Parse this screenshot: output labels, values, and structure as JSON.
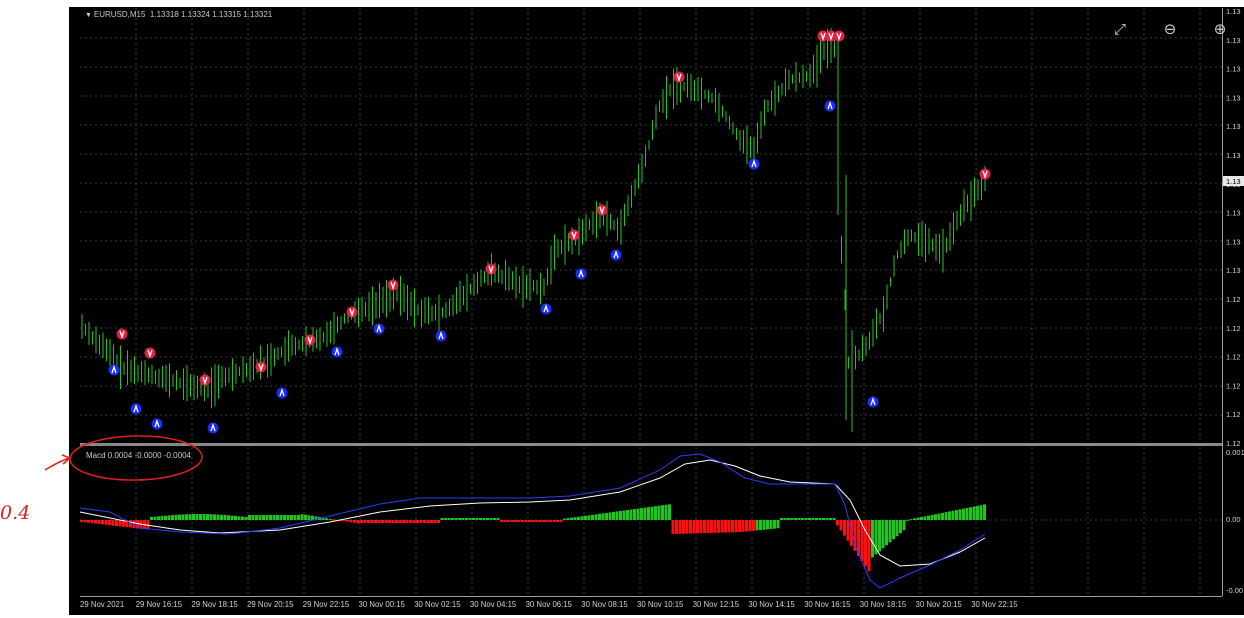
{
  "window": {
    "title": "EURUSD,M15",
    "ohlc": "1.13318 1.13324 1.13315 1.13321"
  },
  "zoom_controls": {
    "fit_icon": "fullscreen-icon",
    "zoom_out_icon": "zoom-out-icon",
    "zoom_in_icon": "zoom-in-icon"
  },
  "price_axis": {
    "labels": [
      "1.13",
      "1.13",
      "1.13",
      "1.13",
      "1.13",
      "1.13",
      "1.13",
      "1.13",
      "1.13",
      "1.13",
      "1.12",
      "1.12",
      "1.12",
      "1.12",
      "1.12",
      "1.12"
    ],
    "current_price": "1.13"
  },
  "time_axis": {
    "labels": [
      "29 Nov 2021",
      "29 Nov 16:15",
      "29 Nov 18:15",
      "29 Nov 20:15",
      "29 Nov 22:15",
      "30 Nov 00:15",
      "30 Nov 02:15",
      "30 Nov 04:15",
      "30 Nov 06:15",
      "30 Nov 08:15",
      "30 Nov 10:15",
      "30 Nov 12:15",
      "30 Nov 14:15",
      "30 Nov 16:15",
      "30 Nov 18:15",
      "30 Nov 20:15",
      "30 Nov 22:15"
    ]
  },
  "macd": {
    "label": "Macd 0.0004 -0.0000 -0.0004",
    "axis_labels": [
      "0.001",
      "0.00",
      "-0.00"
    ]
  },
  "annotation": {
    "text": "0.4",
    "color": "#e02020"
  },
  "colors": {
    "background": "#000000",
    "bars": "#22c422",
    "grid": "#3a3a3a",
    "hist_up": "#22c422",
    "hist_down": "#ff1010",
    "macd_line": "#2b3cff",
    "signal_line": "#ffffff",
    "arrow_up": "#1a2cff",
    "arrow_down": "#e0213f"
  }
}
